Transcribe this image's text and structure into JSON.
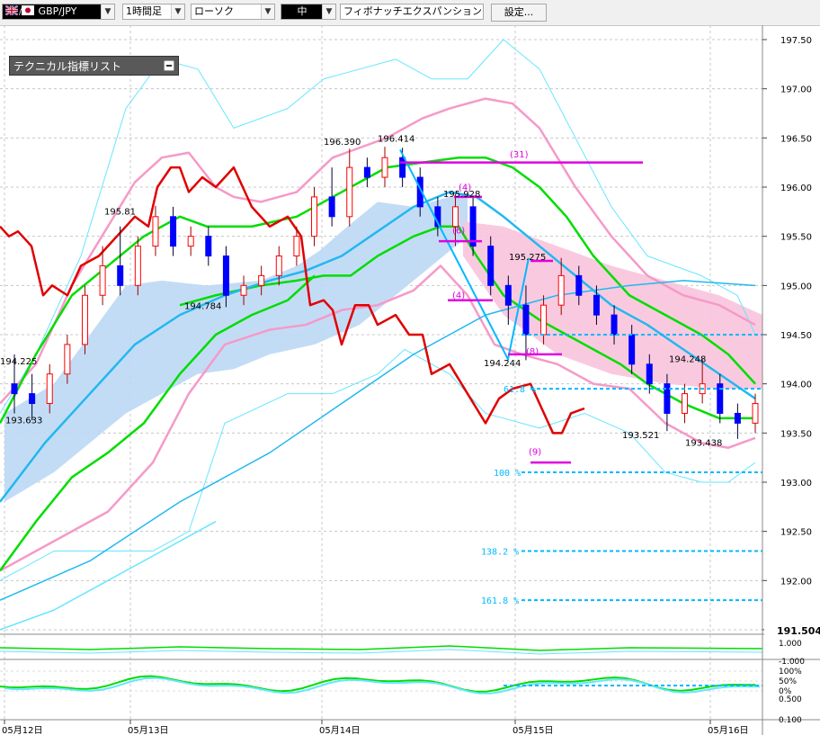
{
  "toolbar": {
    "pair": "GBP/JPY",
    "timeframe": "1時間足",
    "chart_style": "ローソク",
    "size": "中",
    "indicator": "フィボナッチエクスパンション",
    "settings": "設定..."
  },
  "panel": {
    "title": "テクニカル指標リスト"
  },
  "colors": {
    "bull": "#ff0000",
    "bear": "#0000ff",
    "ma_red": "#e00000",
    "ma_pink": "#f59ac8",
    "ma_green": "#00dd00",
    "ma_blue": "#22b8f0",
    "bb_outer": "#66e6ff",
    "cloud_blue": "#bcd8f4",
    "cloud_pink": "#f8c4dc",
    "fib": "#00b8ff",
    "magenta": "#e000e0"
  },
  "price_axis": {
    "labels": [
      "197.50",
      "197.00",
      "196.50",
      "196.00",
      "195.50",
      "195.00",
      "194.50",
      "194.00",
      "193.50",
      "193.00",
      "192.50",
      "192.00",
      "191.50"
    ],
    "current": "191.504"
  },
  "osc_axis": {
    "labels": [
      "1.000",
      "-1.000",
      "100%",
      "50%",
      "0%",
      "0.500",
      "0.100"
    ]
  },
  "time_axis": {
    "labels": [
      "05月12日",
      "05月13日",
      "05月14日",
      "05月15日",
      "05月16日"
    ]
  },
  "annotations": [
    {
      "text": "194.225"
    },
    {
      "text": "193.633"
    },
    {
      "text": "195.81"
    },
    {
      "text": "194.784"
    },
    {
      "text": "196.390"
    },
    {
      "text": "196.414"
    },
    {
      "text": "195.928"
    },
    {
      "text": "(4)"
    },
    {
      "text": "(6)"
    },
    {
      "text": "(4)"
    },
    {
      "text": "194.244"
    },
    {
      "text": "195.275"
    },
    {
      "text": "(8)"
    },
    {
      "text": "(31)"
    },
    {
      "text": "(9)"
    },
    {
      "text": "193.521"
    },
    {
      "text": "194.248"
    },
    {
      "text": "193.438"
    }
  ],
  "fib_labels": [
    "61.8 %",
    "100 %",
    "138.2 %",
    "161.8 %"
  ],
  "chart_data": {
    "type": "line",
    "y_range": [
      191.5,
      197.5
    ],
    "candles_ohlc": [
      [
        194.0,
        194.3,
        193.7,
        193.9
      ],
      [
        193.9,
        194.1,
        193.63,
        193.8
      ],
      [
        193.8,
        194.2,
        193.7,
        194.1
      ],
      [
        194.1,
        194.5,
        194.0,
        194.4
      ],
      [
        194.4,
        195.0,
        194.3,
        194.9
      ],
      [
        194.9,
        195.4,
        194.8,
        195.2
      ],
      [
        195.2,
        195.6,
        194.9,
        195.0
      ],
      [
        195.0,
        195.5,
        194.9,
        195.4
      ],
      [
        195.4,
        195.81,
        195.3,
        195.7
      ],
      [
        195.7,
        195.8,
        195.3,
        195.4
      ],
      [
        195.4,
        195.6,
        195.3,
        195.5
      ],
      [
        195.5,
        195.6,
        195.2,
        195.3
      ],
      [
        195.3,
        195.4,
        194.78,
        194.9
      ],
      [
        194.9,
        195.1,
        194.8,
        195.0
      ],
      [
        195.0,
        195.2,
        194.9,
        195.1
      ],
      [
        195.1,
        195.4,
        195.0,
        195.3
      ],
      [
        195.3,
        195.6,
        195.2,
        195.5
      ],
      [
        195.5,
        196.0,
        195.4,
        195.9
      ],
      [
        195.9,
        196.2,
        195.6,
        195.7
      ],
      [
        195.7,
        196.39,
        195.6,
        196.2
      ],
      [
        196.2,
        196.3,
        196.0,
        196.1
      ],
      [
        196.1,
        196.41,
        196.0,
        196.3
      ],
      [
        196.3,
        196.4,
        196.0,
        196.1
      ],
      [
        196.1,
        196.2,
        195.7,
        195.8
      ],
      [
        195.8,
        195.9,
        195.5,
        195.6
      ],
      [
        195.6,
        195.93,
        195.4,
        195.8
      ],
      [
        195.8,
        195.9,
        195.3,
        195.4
      ],
      [
        195.4,
        195.5,
        194.9,
        195.0
      ],
      [
        195.0,
        195.1,
        194.6,
        194.8
      ],
      [
        194.8,
        195.0,
        194.24,
        194.5
      ],
      [
        194.5,
        194.9,
        194.4,
        194.8
      ],
      [
        194.8,
        195.28,
        194.7,
        195.1
      ],
      [
        195.1,
        195.2,
        194.8,
        194.9
      ],
      [
        194.9,
        195.0,
        194.6,
        194.7
      ],
      [
        194.7,
        194.8,
        194.4,
        194.5
      ],
      [
        194.5,
        194.6,
        194.1,
        194.2
      ],
      [
        194.2,
        194.3,
        193.9,
        194.0
      ],
      [
        194.0,
        194.1,
        193.52,
        193.7
      ],
      [
        193.7,
        194.0,
        193.6,
        193.9
      ],
      [
        193.9,
        194.25,
        193.8,
        194.0
      ],
      [
        194.0,
        194.1,
        193.6,
        193.7
      ],
      [
        193.7,
        193.8,
        193.44,
        193.6
      ],
      [
        193.6,
        193.9,
        193.5,
        193.8
      ]
    ],
    "annotated_prices": [
      194.225,
      193.633,
      195.81,
      194.784,
      196.39,
      196.414,
      195.928,
      194.244,
      195.275,
      193.521,
      194.248,
      193.438
    ]
  }
}
